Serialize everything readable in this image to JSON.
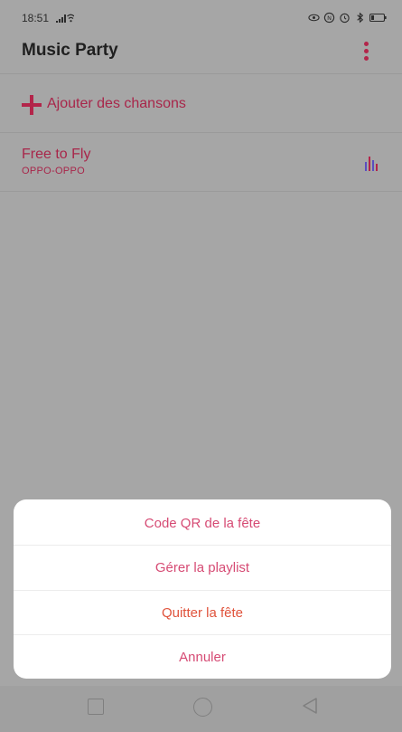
{
  "status_bar": {
    "time": "18:51",
    "icons": [
      "signal-icon",
      "wifi-icon",
      "eye-comfort-icon",
      "nfc-icon",
      "alarm-icon",
      "bluetooth-icon",
      "battery-icon"
    ]
  },
  "app_bar": {
    "title": "Music Party",
    "menu_icon": "more-vertical-icon"
  },
  "add_songs": {
    "icon": "plus-icon",
    "label": "Ajouter des chansons"
  },
  "playlist": [
    {
      "title": "Free to Fly",
      "artist": "OPPO-OPPO",
      "playing_icon": "equalizer-icon"
    }
  ],
  "action_sheet": {
    "items": [
      {
        "label": "Code QR de la fête",
        "color": "#d64b74"
      },
      {
        "label": "Gérer la playlist",
        "color": "#d64b74"
      },
      {
        "label": "Quitter la fête",
        "color": "#e0533c"
      },
      {
        "label": "Annuler",
        "color": "#d64b74"
      }
    ]
  },
  "nav_bar": {
    "icons": [
      "recents-square-icon",
      "home-circle-icon",
      "back-triangle-icon"
    ]
  },
  "colors": {
    "accent": "#a8264a",
    "overlay_bg": "#a6a6a6",
    "sheet_bg": "#ffffff"
  }
}
